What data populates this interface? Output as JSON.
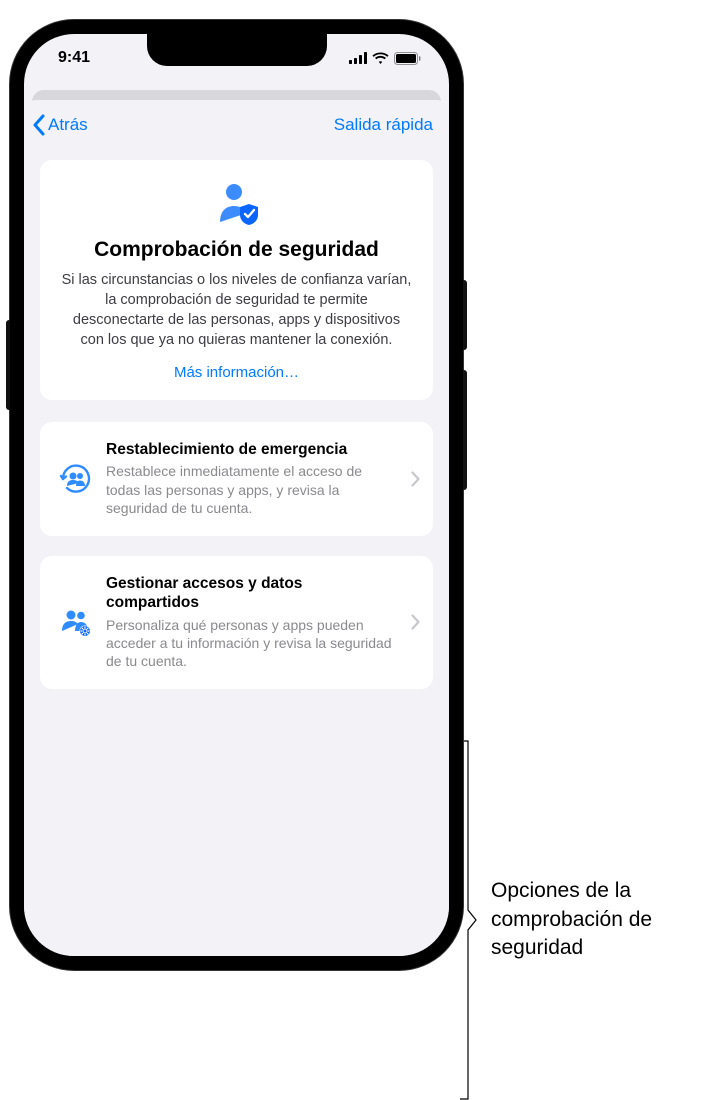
{
  "status": {
    "time": "9:41"
  },
  "nav": {
    "back": "Atrás",
    "quick_exit": "Salida rápida"
  },
  "hero": {
    "title": "Comprobación de seguridad",
    "description": "Si las circunstancias o los niveles de confianza varían, la comprobación de seguridad te permite desconectarte de las personas, apps y dispositivos con los que ya no quieras mantener la conexión.",
    "more_link": "Más información…"
  },
  "options": [
    {
      "title": "Restablecimiento de emergencia",
      "description": "Restablece inmediatamente el acceso de todas las personas y apps, y revisa la seguridad de tu cuenta."
    },
    {
      "title": "Gestionar accesos y datos compartidos",
      "description": "Personaliza qué personas y apps pueden acceder a tu información y revisa la seguridad de tu cuenta."
    }
  ],
  "annotation": {
    "label": "Opciones de la comprobación de seguridad"
  }
}
